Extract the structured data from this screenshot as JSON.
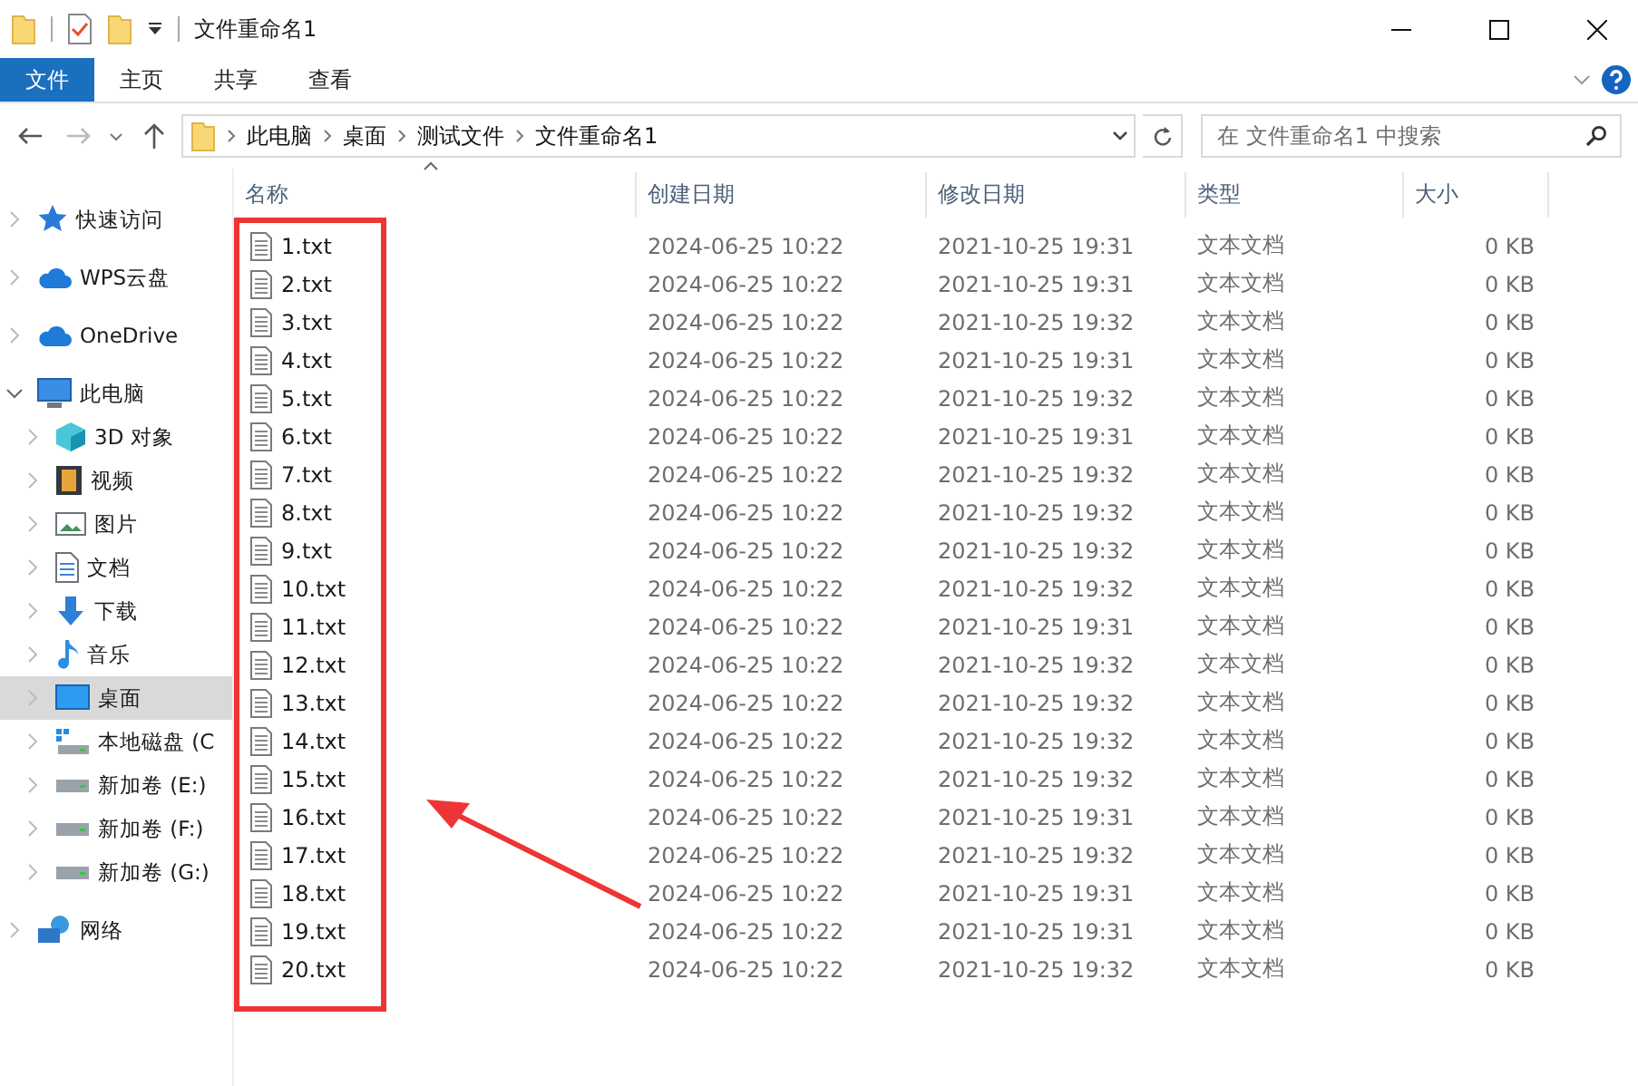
{
  "window": {
    "title": "文件重命名1"
  },
  "ribbon_tabs": [
    {
      "label": "文件",
      "selected": true
    },
    {
      "label": "主页",
      "selected": false
    },
    {
      "label": "共享",
      "selected": false
    },
    {
      "label": "查看",
      "selected": false
    }
  ],
  "address_bar": {
    "crumbs": [
      "此电脑",
      "桌面",
      "测试文件",
      "文件重命名1"
    ]
  },
  "search": {
    "placeholder": "在 文件重命名1 中搜索"
  },
  "sidebar": {
    "items": [
      {
        "label": "快速访问",
        "kind": "star",
        "expanded": false,
        "selected": false
      },
      {
        "label": "WPS云盘",
        "kind": "cloud",
        "expanded": false,
        "selected": false
      },
      {
        "label": "OneDrive",
        "kind": "cloud",
        "expanded": false,
        "selected": false
      },
      {
        "label": "此电脑",
        "kind": "computer",
        "expanded": true,
        "selected": false,
        "children": [
          {
            "label": "3D 对象",
            "kind": "cube",
            "expanded": false,
            "selected": false
          },
          {
            "label": "视频",
            "kind": "film",
            "expanded": false,
            "selected": false
          },
          {
            "label": "图片",
            "kind": "image",
            "expanded": false,
            "selected": false
          },
          {
            "label": "文档",
            "kind": "document",
            "expanded": false,
            "selected": false
          },
          {
            "label": "下载",
            "kind": "download",
            "expanded": false,
            "selected": false
          },
          {
            "label": "音乐",
            "kind": "music",
            "expanded": false,
            "selected": false
          },
          {
            "label": "桌面",
            "kind": "desktop",
            "expanded": false,
            "selected": true
          },
          {
            "label": "本地磁盘 (C",
            "kind": "system-drive",
            "expanded": false,
            "selected": false
          },
          {
            "label": "新加卷 (E:)",
            "kind": "drive",
            "expanded": false,
            "selected": false
          },
          {
            "label": "新加卷 (F:)",
            "kind": "drive",
            "expanded": false,
            "selected": false
          },
          {
            "label": "新加卷 (G:)",
            "kind": "drive",
            "expanded": false,
            "selected": false
          }
        ]
      },
      {
        "label": "网络",
        "kind": "network",
        "expanded": false,
        "selected": false
      }
    ]
  },
  "table": {
    "columns": [
      "名称",
      "创建日期",
      "修改日期",
      "类型",
      "大小"
    ],
    "rows": [
      {
        "name": "1.txt",
        "created": "2024-06-25 10:22",
        "modified": "2021-10-25 19:31",
        "type": "文本文档",
        "size": "0 KB"
      },
      {
        "name": "2.txt",
        "created": "2024-06-25 10:22",
        "modified": "2021-10-25 19:31",
        "type": "文本文档",
        "size": "0 KB"
      },
      {
        "name": "3.txt",
        "created": "2024-06-25 10:22",
        "modified": "2021-10-25 19:32",
        "type": "文本文档",
        "size": "0 KB"
      },
      {
        "name": "4.txt",
        "created": "2024-06-25 10:22",
        "modified": "2021-10-25 19:31",
        "type": "文本文档",
        "size": "0 KB"
      },
      {
        "name": "5.txt",
        "created": "2024-06-25 10:22",
        "modified": "2021-10-25 19:32",
        "type": "文本文档",
        "size": "0 KB"
      },
      {
        "name": "6.txt",
        "created": "2024-06-25 10:22",
        "modified": "2021-10-25 19:31",
        "type": "文本文档",
        "size": "0 KB"
      },
      {
        "name": "7.txt",
        "created": "2024-06-25 10:22",
        "modified": "2021-10-25 19:32",
        "type": "文本文档",
        "size": "0 KB"
      },
      {
        "name": "8.txt",
        "created": "2024-06-25 10:22",
        "modified": "2021-10-25 19:32",
        "type": "文本文档",
        "size": "0 KB"
      },
      {
        "name": "9.txt",
        "created": "2024-06-25 10:22",
        "modified": "2021-10-25 19:32",
        "type": "文本文档",
        "size": "0 KB"
      },
      {
        "name": "10.txt",
        "created": "2024-06-25 10:22",
        "modified": "2021-10-25 19:32",
        "type": "文本文档",
        "size": "0 KB"
      },
      {
        "name": "11.txt",
        "created": "2024-06-25 10:22",
        "modified": "2021-10-25 19:31",
        "type": "文本文档",
        "size": "0 KB"
      },
      {
        "name": "12.txt",
        "created": "2024-06-25 10:22",
        "modified": "2021-10-25 19:32",
        "type": "文本文档",
        "size": "0 KB"
      },
      {
        "name": "13.txt",
        "created": "2024-06-25 10:22",
        "modified": "2021-10-25 19:32",
        "type": "文本文档",
        "size": "0 KB"
      },
      {
        "name": "14.txt",
        "created": "2024-06-25 10:22",
        "modified": "2021-10-25 19:32",
        "type": "文本文档",
        "size": "0 KB"
      },
      {
        "name": "15.txt",
        "created": "2024-06-25 10:22",
        "modified": "2021-10-25 19:32",
        "type": "文本文档",
        "size": "0 KB"
      },
      {
        "name": "16.txt",
        "created": "2024-06-25 10:22",
        "modified": "2021-10-25 19:31",
        "type": "文本文档",
        "size": "0 KB"
      },
      {
        "name": "17.txt",
        "created": "2024-06-25 10:22",
        "modified": "2021-10-25 19:32",
        "type": "文本文档",
        "size": "0 KB"
      },
      {
        "name": "18.txt",
        "created": "2024-06-25 10:22",
        "modified": "2021-10-25 19:31",
        "type": "文本文档",
        "size": "0 KB"
      },
      {
        "name": "19.txt",
        "created": "2024-06-25 10:22",
        "modified": "2021-10-25 19:31",
        "type": "文本文档",
        "size": "0 KB"
      },
      {
        "name": "20.txt",
        "created": "2024-06-25 10:22",
        "modified": "2021-10-25 19:32",
        "type": "文本文档",
        "size": "0 KB"
      }
    ]
  }
}
